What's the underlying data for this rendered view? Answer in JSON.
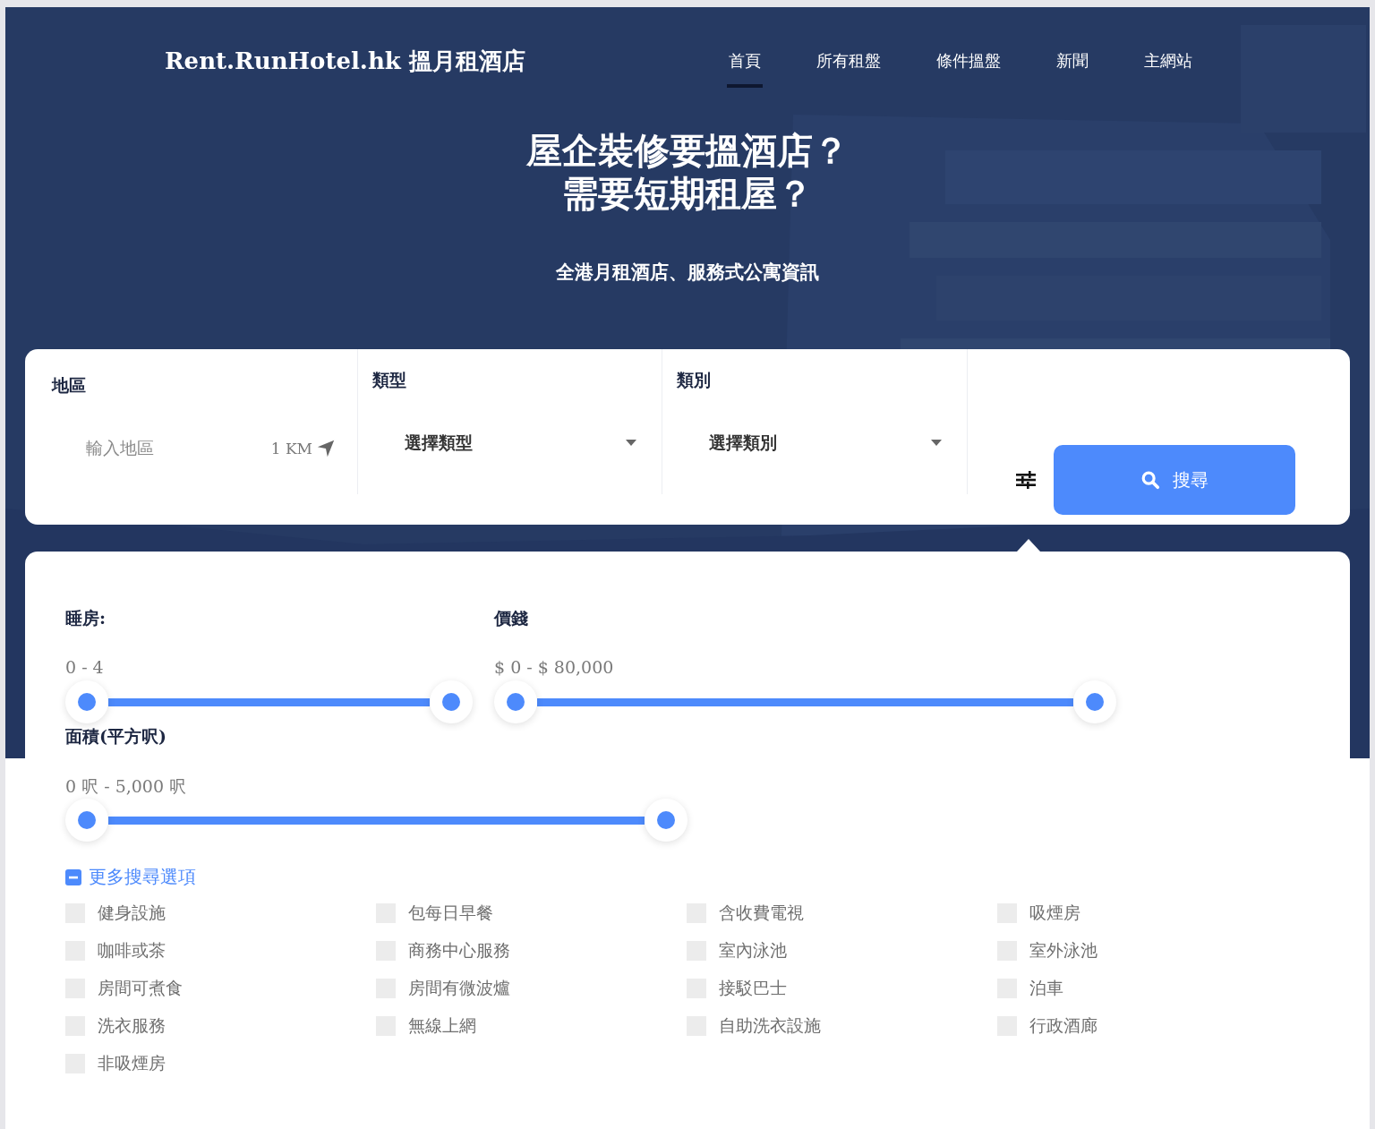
{
  "header": {
    "logo": "Rent.RunHotel.hk 搵月租酒店",
    "nav": [
      {
        "label": "首頁",
        "selected": true
      },
      {
        "label": "所有租盤",
        "selected": false
      },
      {
        "label": "條件搵盤",
        "selected": false
      },
      {
        "label": "新聞",
        "selected": false
      },
      {
        "label": "主網站",
        "selected": false
      }
    ]
  },
  "hero": {
    "title_lines": [
      "屋企裝修要搵酒店？",
      "需要短期租屋？"
    ],
    "subtitle": "全港月租酒店、服務式公寓資訊"
  },
  "search": {
    "district": {
      "label": "地區",
      "placeholder": "輸入地區",
      "radius": "1 KM"
    },
    "type": {
      "label": "類型",
      "value": "選擇類型"
    },
    "category": {
      "label": "類別",
      "value": "選擇類別"
    },
    "button": "搜尋"
  },
  "filters": {
    "sliders": [
      {
        "label": "睡房:",
        "reading": "0 - 4",
        "level": 1
      },
      {
        "label": "價錢",
        "reading": "$ 0 - $ 80,000",
        "level": 1
      },
      {
        "label": "面積(平方呎)",
        "reading": "0 呎 - 5,000 呎",
        "level": 1
      }
    ],
    "more_options": {
      "label": "更多搜尋選項",
      "expanded": true
    },
    "amenities": [
      {
        "label": "健身設施",
        "checked": false
      },
      {
        "label": "包每日早餐",
        "checked": false
      },
      {
        "label": "含收費電視",
        "checked": false
      },
      {
        "label": "吸煙房",
        "checked": false
      },
      {
        "label": "咖啡或茶",
        "checked": false
      },
      {
        "label": "商務中心服務",
        "checked": false
      },
      {
        "label": "室內泳池",
        "checked": false
      },
      {
        "label": "室外泳池",
        "checked": false
      },
      {
        "label": "房間可煮食",
        "checked": false
      },
      {
        "label": "房間有微波爐",
        "checked": false
      },
      {
        "label": "接駁巴士",
        "checked": false
      },
      {
        "label": "泊車",
        "checked": false
      },
      {
        "label": "洗衣服務",
        "checked": false
      },
      {
        "label": "無線上網",
        "checked": false
      },
      {
        "label": "自助洗衣設施",
        "checked": false
      },
      {
        "label": "行政酒廊",
        "checked": false
      },
      {
        "label": "非吸煙房",
        "checked": false
      }
    ]
  }
}
